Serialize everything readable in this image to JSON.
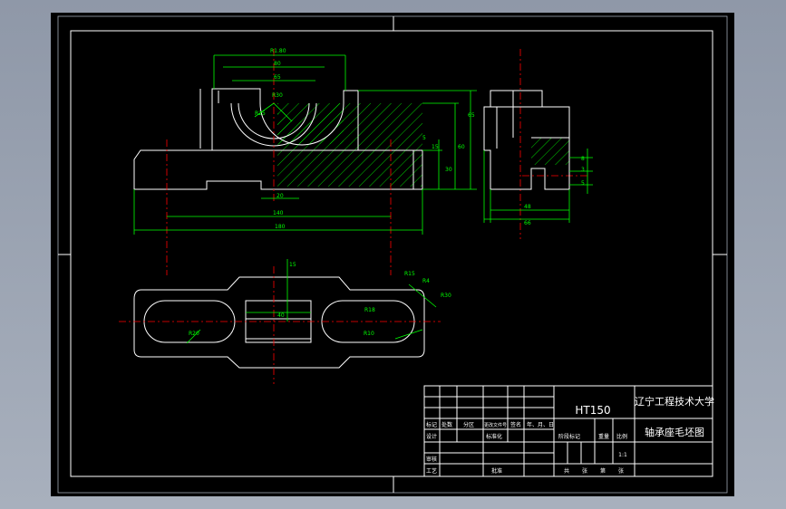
{
  "colors": {
    "background": "#000000",
    "outline": "#ffffff",
    "dimension": "#00ff00",
    "centerline": "#ff0000",
    "frame": "#a0a8b5"
  },
  "title_block": {
    "material": "HT150",
    "school": "辽宁工程技术大学",
    "drawing_name": "轴承座毛坯图",
    "scale": "1:1",
    "row_labels": {
      "designer": "设计",
      "checker": "审核",
      "process": "工艺"
    },
    "header_labels": [
      "标记",
      "处数",
      "分区",
      "更改文件号",
      "签名",
      "年、月、日"
    ],
    "standard_label": "标准化",
    "approve_label": "批准",
    "stage_headers": [
      "阶段标记",
      "重量",
      "比例"
    ],
    "sheet_labels": [
      "共",
      "张",
      "第",
      "张"
    ]
  },
  "dimensions": {
    "front": [
      "R1.80",
      "80",
      "65",
      "R30",
      "R25",
      "5",
      "15",
      "30",
      "60",
      "65",
      "20",
      "140",
      "180"
    ],
    "side": [
      "8",
      "3",
      "5",
      "48",
      "66"
    ],
    "top": [
      "15",
      "40",
      "R15",
      "R4",
      "R18",
      "R10",
      "R20",
      "R30"
    ]
  }
}
